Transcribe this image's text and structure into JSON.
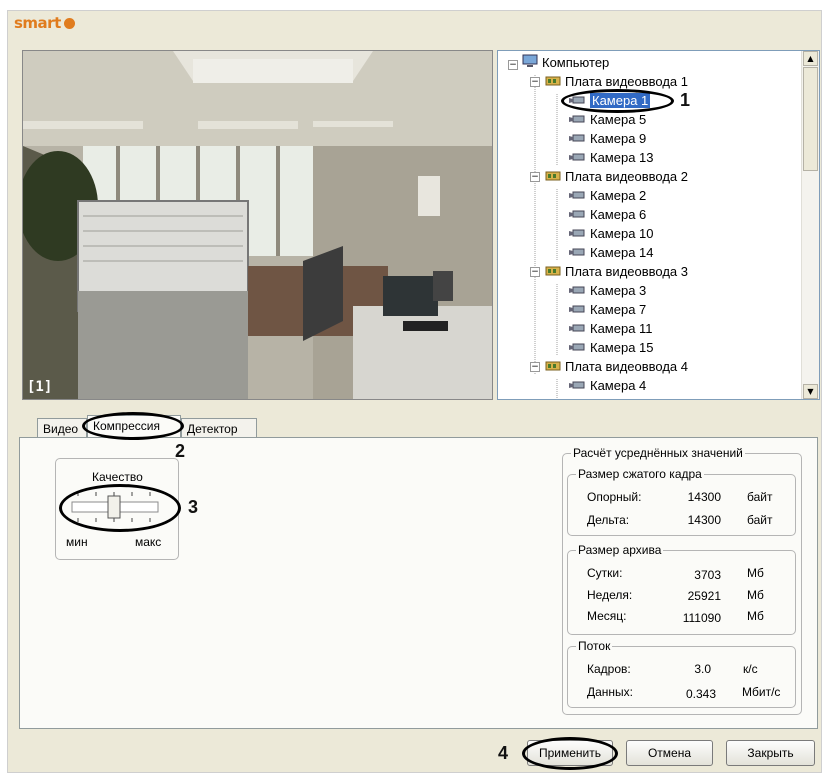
{
  "brand": "smart",
  "video": {
    "label": "[1]"
  },
  "tree": {
    "root": "Компьютер",
    "nodes": [
      {
        "label": "Плата видеоввода 1",
        "level": 1
      },
      {
        "label": "Камера 1",
        "level": 2,
        "selected": true
      },
      {
        "label": "Камера 5",
        "level": 2
      },
      {
        "label": "Камера 9",
        "level": 2
      },
      {
        "label": "Камера 13",
        "level": 2
      },
      {
        "label": "Плата видеоввода 2",
        "level": 1
      },
      {
        "label": "Камера 2",
        "level": 2
      },
      {
        "label": "Камера 6",
        "level": 2
      },
      {
        "label": "Камера 10",
        "level": 2
      },
      {
        "label": "Камера 14",
        "level": 2
      },
      {
        "label": "Плата видеоввода 3",
        "level": 1
      },
      {
        "label": "Камера 3",
        "level": 2
      },
      {
        "label": "Камера 7",
        "level": 2
      },
      {
        "label": "Камера 11",
        "level": 2
      },
      {
        "label": "Камера 15",
        "level": 2
      },
      {
        "label": "Плата видеоввода 4",
        "level": 1
      },
      {
        "label": "Камера 4",
        "level": 2
      }
    ]
  },
  "tabs": {
    "video": "Видео",
    "compression": "Компрессия",
    "detector": "Детектор"
  },
  "quality": {
    "title": "Качество",
    "min": "мин",
    "max": "макс",
    "level": 0.5
  },
  "calc": {
    "title": "Расчёт усреднённых значений",
    "frame": {
      "title": "Размер сжатого кадра",
      "rows": [
        {
          "label": "Опорный:",
          "value": "14300",
          "unit": "байт"
        },
        {
          "label": "Дельта:",
          "value": "14300",
          "unit": "байт"
        }
      ]
    },
    "archive": {
      "title": "Размер архива",
      "rows": [
        {
          "label": "Сутки:",
          "value": "3703",
          "unit": "Мб"
        },
        {
          "label": "Неделя:",
          "value": "25921",
          "unit": "Мб"
        },
        {
          "label": "Месяц:",
          "value": "111090",
          "unit": "Мб"
        }
      ]
    },
    "stream": {
      "title": "Поток",
      "rows": [
        {
          "label": "Кадров:",
          "value": "3.0",
          "unit": "к/с"
        },
        {
          "label": "Данных:",
          "value": "0.343",
          "unit": "Мбит/с"
        }
      ]
    }
  },
  "buttons": {
    "apply": "Применить",
    "cancel": "Отмена",
    "close": "Закрыть"
  },
  "callouts": {
    "c1": "1",
    "c2": "2",
    "c3": "3",
    "c4": "4"
  }
}
